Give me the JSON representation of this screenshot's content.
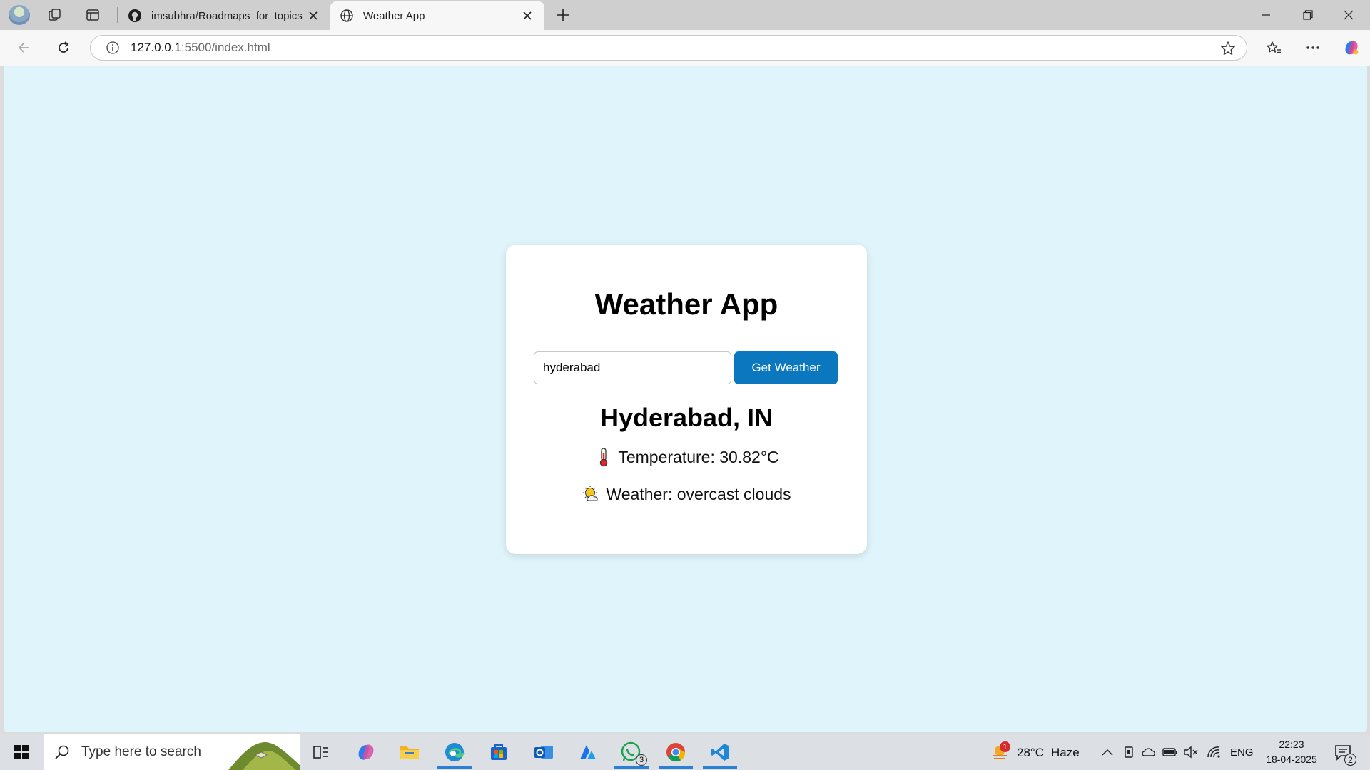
{
  "browser": {
    "tabs": [
      {
        "title": "imsubhra/Roadmaps_for_topics_c",
        "active": false,
        "icon": "github-icon"
      },
      {
        "title": "Weather App",
        "active": true,
        "icon": "globe-icon"
      }
    ],
    "address": {
      "host": "127.0.0.1",
      "rest": ":5500/index.html"
    }
  },
  "app": {
    "title": "Weather App",
    "search": {
      "value": "hyderabad",
      "button_label": "Get Weather"
    },
    "result": {
      "city": "Hyderabad, IN",
      "temperature": "Temperature: 30.82°C",
      "temperature_icon": "🌡",
      "weather": "Weather: overcast clouds",
      "weather_icon": "🌥"
    }
  },
  "taskbar": {
    "search_placeholder": "Type here to search",
    "weather": {
      "temp": "28°C",
      "condition": "Haze",
      "alert_count": "1"
    },
    "whatsapp_badge": "3",
    "language": "ENG",
    "time": "22:23",
    "date": "18-04-2025",
    "notifications": "2"
  },
  "colors": {
    "page_bg": "#dff4fb",
    "button": "#0a77bf"
  }
}
